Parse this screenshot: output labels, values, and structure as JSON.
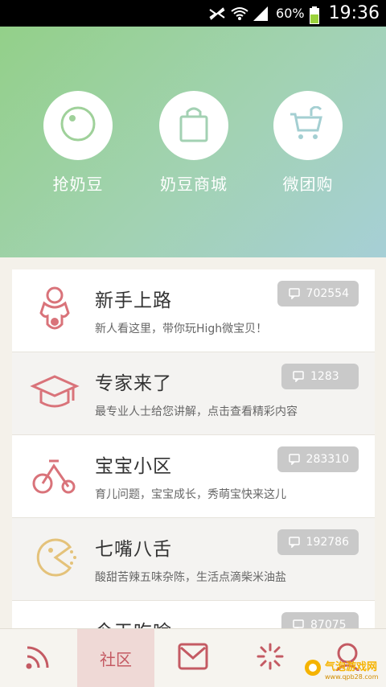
{
  "status_bar": {
    "battery": "60%",
    "time": "19:36"
  },
  "hero": {
    "items": [
      {
        "label": "抢奶豆",
        "icon": "camera-lens-icon"
      },
      {
        "label": "奶豆商城",
        "icon": "shopping-bag-icon"
      },
      {
        "label": "微团购",
        "icon": "shopping-cart-icon"
      }
    ]
  },
  "list": {
    "items": [
      {
        "title": "新手上路",
        "desc": "新人看这里，带你玩High微宝贝！",
        "count": "702554",
        "icon": "baby-icon",
        "color": "#d9737a"
      },
      {
        "title": "专家来了",
        "desc": "最专业人士给您讲解，点击查看精彩内容",
        "count": "1283",
        "icon": "graduation-cap-icon",
        "color": "#d9737a"
      },
      {
        "title": "宝宝小区",
        "desc": "育儿问题，宝宝成长，秀萌宝快来这儿",
        "count": "283310",
        "icon": "tricycle-icon",
        "color": "#d9737a"
      },
      {
        "title": "七嘴八舌",
        "desc": "酸甜苦辣五味杂陈，生活点滴柴米油盐",
        "count": "192786",
        "icon": "chatter-face-icon",
        "color": "#e4c27a"
      },
      {
        "title": "今天吃啥",
        "desc": "",
        "count": "87075",
        "icon": "food-icon",
        "color": "#6db3d6"
      }
    ]
  },
  "tabbar": {
    "tabs": [
      {
        "label": "",
        "icon": "rss-icon"
      },
      {
        "label": "社区",
        "icon": ""
      },
      {
        "label": "",
        "icon": "mail-icon"
      },
      {
        "label": "",
        "icon": "spinner-icon"
      },
      {
        "label": "",
        "icon": "user-icon"
      }
    ]
  },
  "watermark": {
    "text": "气泡游戏网",
    "sub": "www.qpb28.com"
  }
}
